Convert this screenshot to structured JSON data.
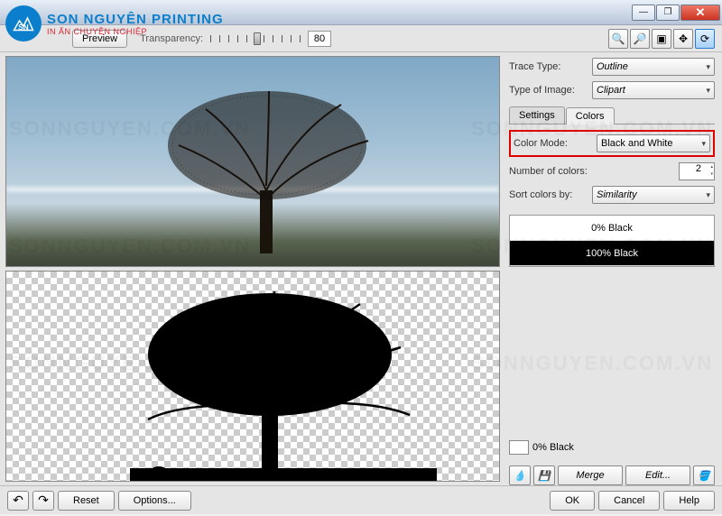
{
  "logo": {
    "brand": "SON NGUYÊN PRINTING",
    "tagline": "IN ẤN CHUYÊN NGHIỆP"
  },
  "toolbar": {
    "preview_label": "Preview",
    "transparency_label": "Transparency:",
    "transparency_value": "80"
  },
  "trace": {
    "type_label": "Trace Type:",
    "type_value": "Outline",
    "image_type_label": "Type of Image:",
    "image_type_value": "Clipart"
  },
  "tabs": {
    "settings": "Settings",
    "colors": "Colors"
  },
  "colors_panel": {
    "mode_label": "Color Mode:",
    "mode_value": "Black and White",
    "num_label": "Number of colors:",
    "num_value": "2",
    "sort_label": "Sort colors by:",
    "sort_value": "Similarity",
    "items": [
      {
        "label": "0% Black"
      },
      {
        "label": "100% Black"
      }
    ],
    "selected_swatch_label": "0% Black"
  },
  "side_actions": {
    "merge": "Merge",
    "edit": "Edit..."
  },
  "footer": {
    "reset": "Reset",
    "options": "Options...",
    "ok": "OK",
    "cancel": "Cancel",
    "help": "Help"
  },
  "watermark": "SONNGUYEN.COM.VN"
}
